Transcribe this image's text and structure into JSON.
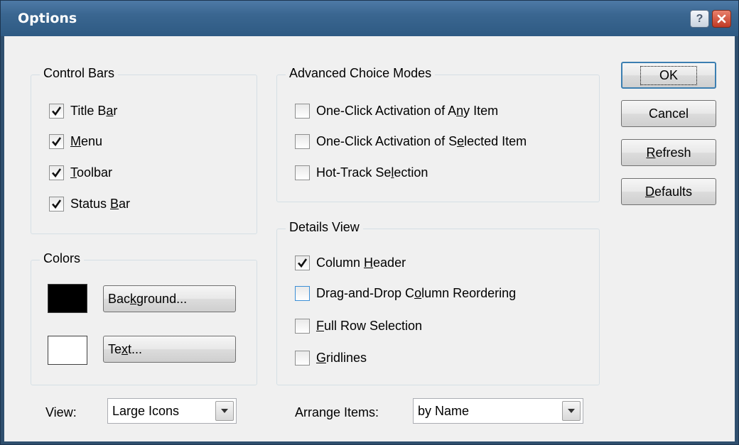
{
  "window": {
    "title": "Options",
    "help_glyph": "?",
    "close_glyph": "✕"
  },
  "control_bars": {
    "legend": "Control Bars",
    "items": [
      {
        "pre": "",
        "key": "",
        "post": "Title B",
        "key2": "a",
        "post2": "r",
        "checked": true
      },
      {
        "pre": "",
        "key": "M",
        "post": "enu",
        "checked": true
      },
      {
        "pre": "",
        "key": "T",
        "post": "oolbar",
        "checked": true
      },
      {
        "pre": "Status ",
        "key": "B",
        "post": "ar",
        "checked": true
      }
    ]
  },
  "advanced": {
    "legend": "Advanced Choice Modes",
    "items": [
      {
        "pre": "One-Click Activation of A",
        "key": "n",
        "post": "y Item",
        "checked": false
      },
      {
        "pre": "One-Click Activation of S",
        "key": "e",
        "post": "lected Item",
        "checked": false
      },
      {
        "pre": "Hot-Track Se",
        "key": "l",
        "post": "ection",
        "checked": false
      }
    ]
  },
  "colors": {
    "legend": "Colors",
    "background_color": "#000000",
    "text_color": "#ffffff",
    "background_btn": {
      "pre": "Bac",
      "key": "k",
      "post": "ground..."
    },
    "text_btn": {
      "pre": "Te",
      "key": "x",
      "post": "t..."
    }
  },
  "details": {
    "legend": "Details View",
    "items": [
      {
        "pre": "Column ",
        "key": "H",
        "post": "eader",
        "checked": true
      },
      {
        "pre": "Drag-and-Drop C",
        "key": "o",
        "post": "lumn Reordering",
        "checked": false,
        "focus": true
      },
      {
        "pre": "",
        "key": "F",
        "post": "ull Row Selection",
        "checked": false
      },
      {
        "pre": "",
        "key": "G",
        "post": "ridlines",
        "checked": false
      }
    ]
  },
  "buttons": {
    "ok": "OK",
    "cancel": "Cancel",
    "refresh": {
      "pre": "",
      "key": "R",
      "post": "efresh"
    },
    "defaults": {
      "pre": "",
      "key": "D",
      "post": "efaults"
    }
  },
  "view": {
    "label": "View:",
    "value": "Large Icons"
  },
  "arrange": {
    "label": "Arrange Items:",
    "value": "by Name"
  },
  "accent": "#3c7fb1"
}
